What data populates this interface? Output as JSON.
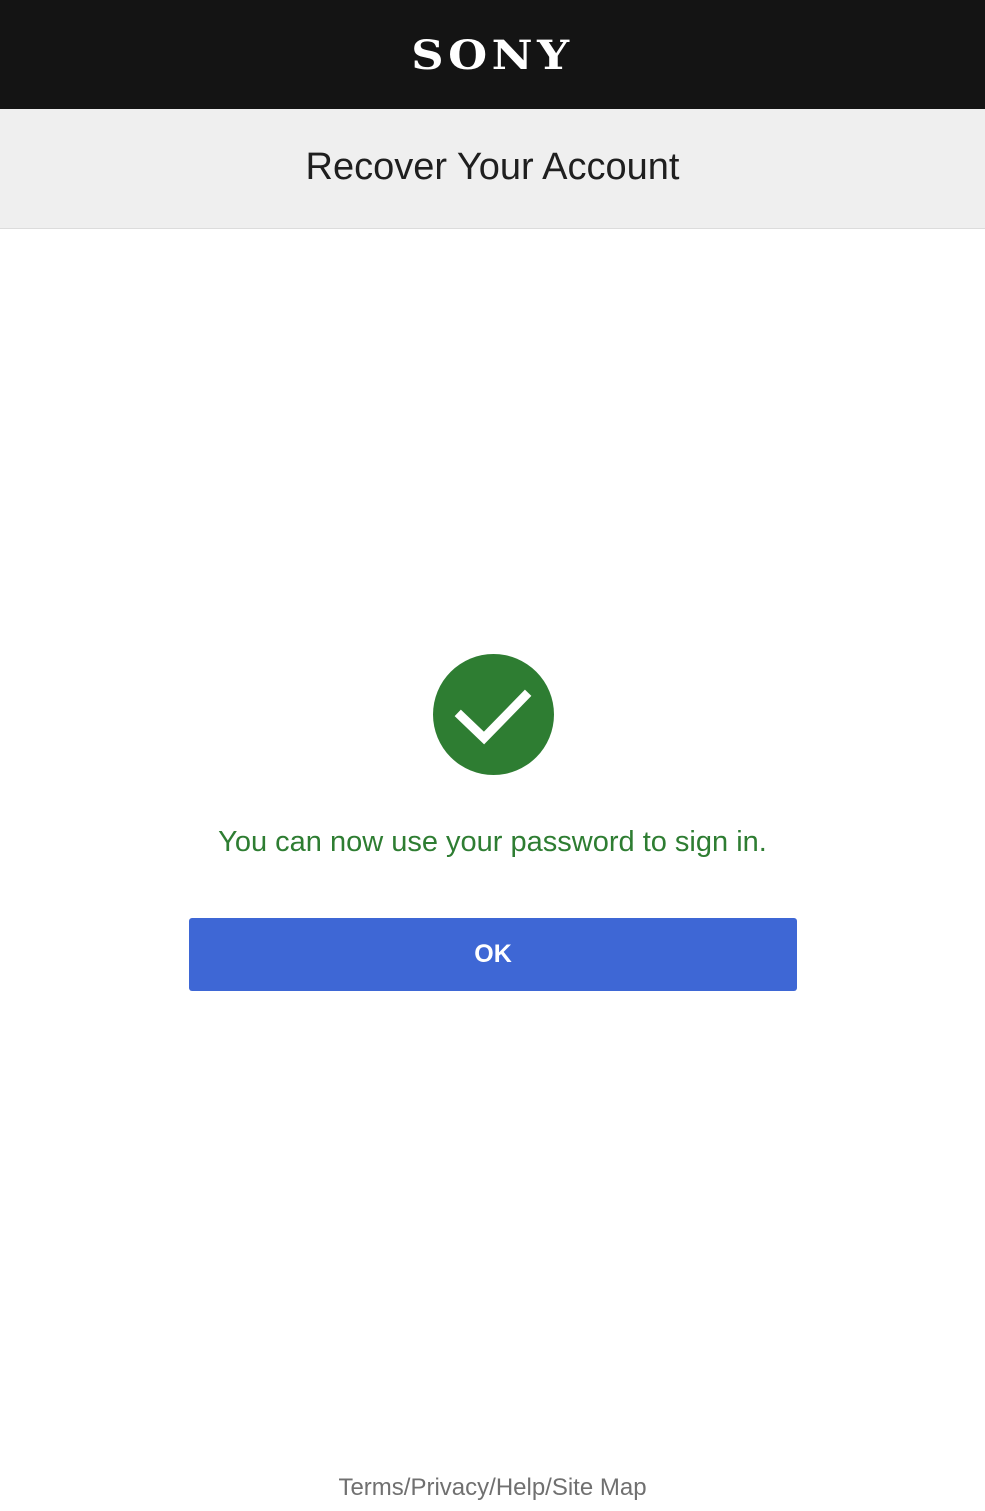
{
  "header": {
    "logo_text": "SONY"
  },
  "page": {
    "title": "Recover Your Account"
  },
  "status": {
    "icon": "check-circle-icon",
    "icon_color": "#2e7d32",
    "message": "You can now use your password to sign in.",
    "message_color": "#2e7d32"
  },
  "actions": {
    "ok_label": "OK",
    "ok_color": "#3e67d5"
  },
  "footer": {
    "links": [
      {
        "label": "Terms"
      },
      {
        "label": "Privacy"
      },
      {
        "label": "Help"
      },
      {
        "label": "Site Map"
      }
    ],
    "separator": "/"
  }
}
